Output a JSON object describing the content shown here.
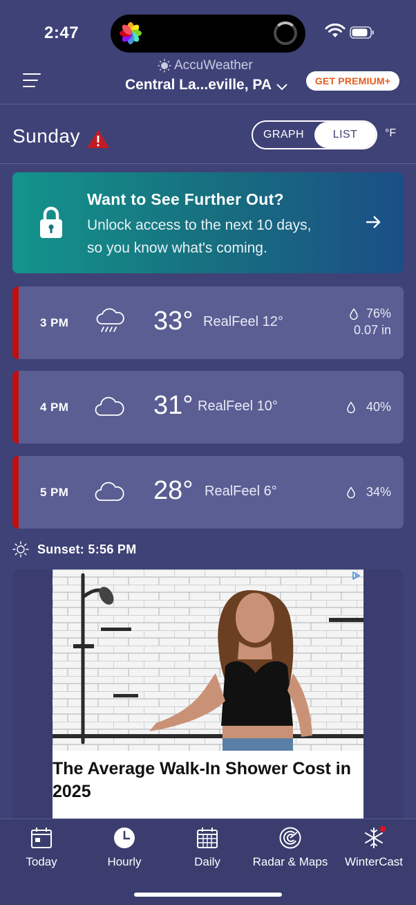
{
  "status_bar": {
    "time": "2:47"
  },
  "header": {
    "brand": "AccuWeather",
    "location": "Central La...eville, PA",
    "premium_label": "GET PREMIUM+"
  },
  "day_row": {
    "day": "Sunday",
    "view_toggle": {
      "options": [
        "GRAPH",
        "LIST"
      ],
      "selected": "LIST"
    },
    "unit": "°F"
  },
  "promo": {
    "title": "Want to See Further Out?",
    "line1": "Unlock access to the next 10 days,",
    "line2": "so you know what's coming."
  },
  "hourly": [
    {
      "time": "3 PM",
      "icon": "rain-cloud-icon",
      "temp": "33°",
      "realfeel": "RealFeel 12°",
      "precip_pct": "76%",
      "precip_amt": "0.07 in"
    },
    {
      "time": "4 PM",
      "icon": "cloud-icon",
      "temp": "31°",
      "realfeel": "RealFeel 10°",
      "precip_pct": "40%"
    },
    {
      "time": "5 PM",
      "icon": "cloud-icon",
      "temp": "28°",
      "realfeel": "RealFeel 6°",
      "precip_pct": "34%"
    }
  ],
  "sunset": "Sunset: 5:56 PM",
  "ad": {
    "headline": "The Average Walk-In Shower Cost in 2025"
  },
  "tabbar": {
    "tabs": [
      {
        "label": "Today",
        "icon": "calendar-today-icon"
      },
      {
        "label": "Hourly",
        "icon": "clock-icon"
      },
      {
        "label": "Daily",
        "icon": "calendar-daily-icon"
      },
      {
        "label": "Radar & Maps",
        "icon": "radar-icon"
      },
      {
        "label": "WinterCast",
        "icon": "snowflake-icon"
      }
    ],
    "selected": "Hourly"
  },
  "colors": {
    "background": "#3f4277",
    "card": "#5a5e93",
    "alert_bar": "#c10e0e",
    "premium_text": "#e85a1c",
    "promo_gradient_start": "#14948c",
    "promo_gradient_end": "#1b4e86"
  }
}
